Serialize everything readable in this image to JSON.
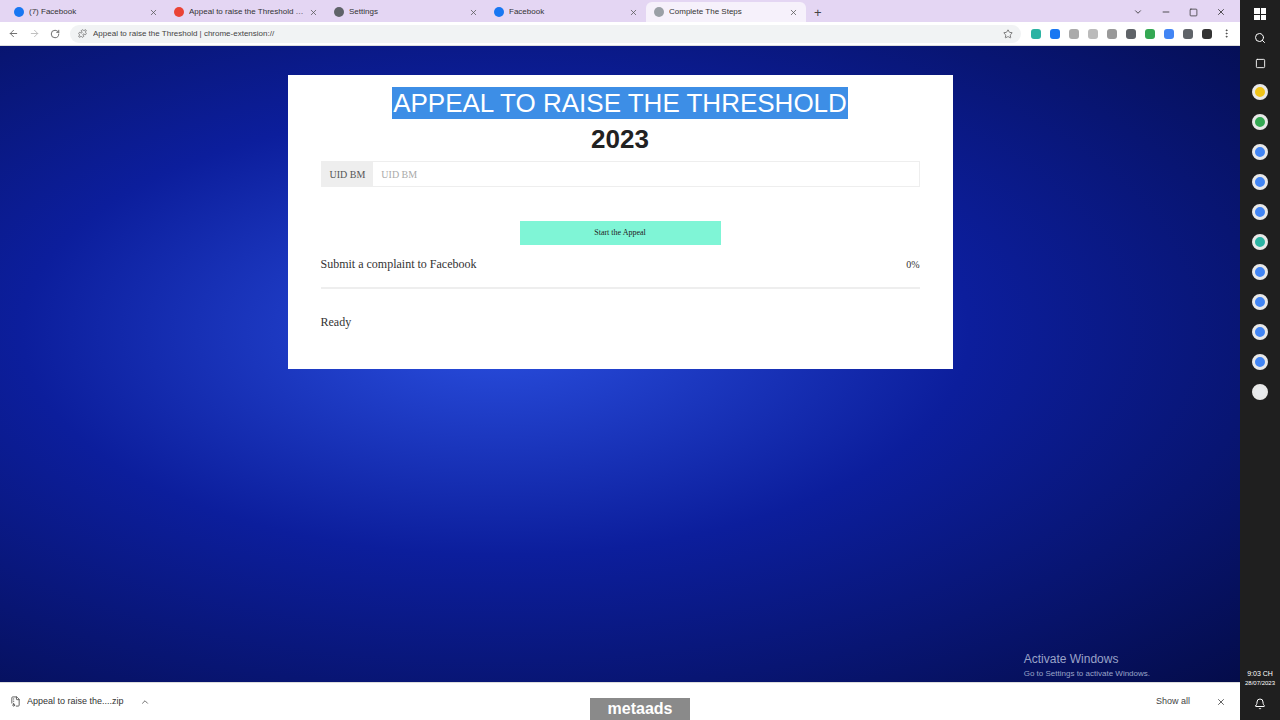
{
  "browser": {
    "tabs": [
      {
        "label": "(7) Facebook",
        "selected": false,
        "color": "#1877f2"
      },
      {
        "label": "Appeal to raise the Threshold -...",
        "selected": false,
        "color": "#ea4335"
      },
      {
        "label": "Settings",
        "selected": false,
        "color": "#5f6368"
      },
      {
        "label": "Facebook",
        "selected": false,
        "color": "#1877f2"
      },
      {
        "label": "Complete The Steps",
        "selected": true,
        "color": "#9aa0a6"
      }
    ],
    "new_tab": "+",
    "address": "Appeal to raise the Threshold  |  chrome-extension://"
  },
  "page": {
    "title": "APPEAL TO RAISE THE THRESHOLD",
    "title_highlighted": true,
    "year": "2023",
    "input": {
      "addon": "UID BM",
      "placeholder": "UID BM"
    },
    "button": "Start the Appeal",
    "progress": {
      "label": "Submit a complaint to Facebook",
      "percent": "0%",
      "level": 0
    },
    "status": "Ready"
  },
  "downloads": {
    "items": [
      {
        "name": "Appeal to raise the....zip"
      }
    ],
    "show_all": "Show all"
  },
  "watermark": {
    "logo": "metaads"
  },
  "activation": {
    "title": "Activate Windows",
    "subtitle": "Go to Settings to activate Windows."
  },
  "taskbar": {
    "time": "9:03 CH",
    "date": "28/07/2023"
  }
}
